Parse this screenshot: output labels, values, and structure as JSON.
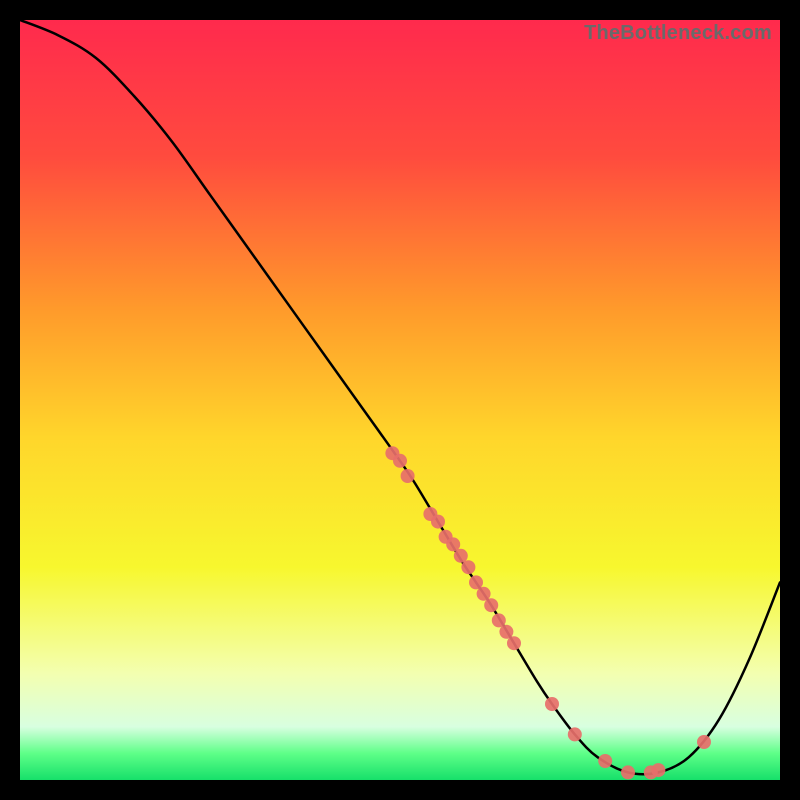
{
  "watermark": "TheBottleneck.com",
  "chart_data": {
    "type": "line",
    "title": "",
    "xlabel": "",
    "ylabel": "",
    "xlim": [
      0,
      100
    ],
    "ylim": [
      0,
      100
    ],
    "grid": false,
    "series": [
      {
        "name": "bottleneck-curve",
        "x": [
          0,
          5,
          10,
          15,
          20,
          25,
          30,
          35,
          40,
          45,
          50,
          52,
          55,
          58,
          60,
          62,
          65,
          68,
          70,
          73,
          76,
          80,
          84,
          88,
          92,
          96,
          100
        ],
        "y": [
          100,
          98,
          95,
          90,
          84,
          77,
          70,
          63,
          56,
          49,
          42,
          39,
          34,
          29,
          26,
          23,
          18,
          13,
          10,
          6,
          3,
          1,
          1,
          3,
          8,
          16,
          26
        ]
      }
    ],
    "markers": {
      "name": "highlight-points",
      "x": [
        49,
        50,
        51,
        54,
        55,
        56,
        57,
        58,
        59,
        60,
        61,
        62,
        63,
        64,
        65,
        70,
        73,
        77,
        80,
        83,
        84,
        90
      ],
      "y": [
        43,
        42,
        40,
        35,
        34,
        32,
        31,
        29.5,
        28,
        26,
        24.5,
        23,
        21,
        19.5,
        18,
        10,
        6,
        2.5,
        1,
        1,
        1.3,
        5
      ]
    },
    "gradient_stops": [
      {
        "offset": 0.0,
        "color": "#ff2a4d"
      },
      {
        "offset": 0.18,
        "color": "#ff4b3e"
      },
      {
        "offset": 0.38,
        "color": "#ff9a2b"
      },
      {
        "offset": 0.55,
        "color": "#ffd62b"
      },
      {
        "offset": 0.72,
        "color": "#f7f72e"
      },
      {
        "offset": 0.86,
        "color": "#f3ffb0"
      },
      {
        "offset": 0.93,
        "color": "#d8ffe0"
      },
      {
        "offset": 0.965,
        "color": "#5eff88"
      },
      {
        "offset": 1.0,
        "color": "#16e06a"
      }
    ]
  }
}
